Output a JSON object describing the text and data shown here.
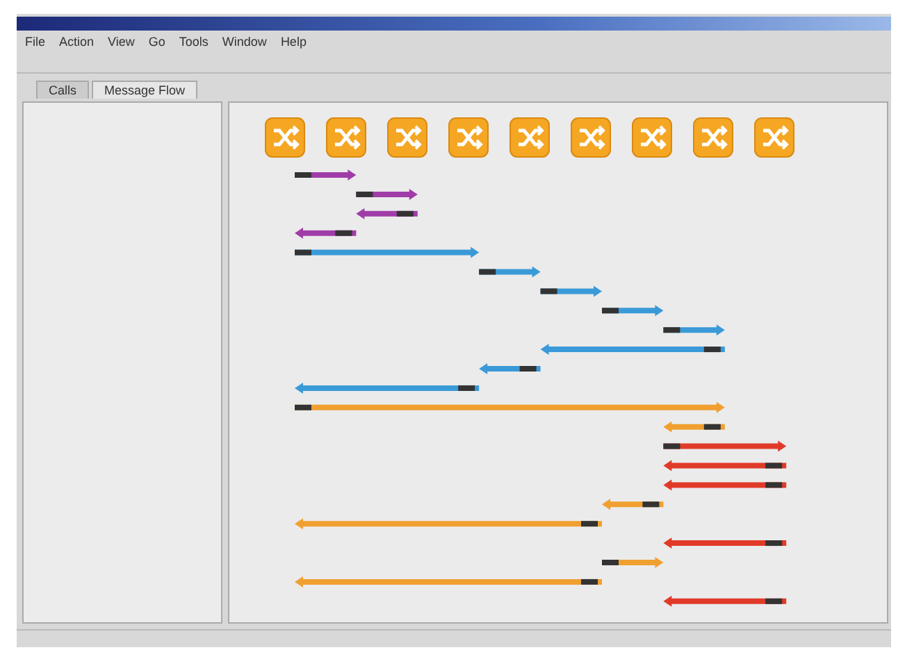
{
  "menu": [
    "File",
    "Action",
    "View",
    "Go",
    "Tools",
    "Window",
    "Help"
  ],
  "tabs": [
    {
      "label": "Calls",
      "selected": false
    },
    {
      "label": "Message Flow",
      "selected": true
    }
  ],
  "nodes": [
    {
      "kind": "switch"
    },
    {
      "kind": "switch"
    },
    {
      "kind": "switch"
    },
    {
      "kind": "switch"
    },
    {
      "kind": "switch"
    },
    {
      "kind": "switch"
    },
    {
      "kind": "switch"
    },
    {
      "kind": "switch"
    },
    {
      "kind": "switch"
    }
  ],
  "messages": [
    {
      "color": "#a03ca8",
      "lanes": [
        {
          "kind": "tail"
        },
        {
          "kind": "head"
        }
      ]
    },
    {
      "color": "#a03ca8",
      "lanes": [
        {
          "kind": "none"
        },
        {
          "kind": "tail"
        },
        {
          "kind": "head"
        }
      ]
    },
    {
      "color": "#a03ca8",
      "lanes": [
        {
          "kind": "none"
        },
        {
          "kind": "head"
        },
        {
          "kind": "tail"
        }
      ]
    },
    {
      "color": "#a03ca8",
      "lanes": [
        {
          "kind": "head"
        },
        {
          "kind": "tail"
        }
      ]
    },
    {
      "color": "#3a9ad8",
      "lanes": [
        {
          "kind": "tail"
        },
        {
          "kind": "pass"
        },
        {
          "kind": "pass"
        },
        {
          "kind": "head"
        }
      ]
    },
    {
      "color": "#3a9ad8",
      "lanes": [
        {
          "kind": "none"
        },
        {
          "kind": "none"
        },
        {
          "kind": "none"
        },
        {
          "kind": "tail"
        },
        {
          "kind": "head"
        }
      ]
    },
    {
      "color": "#3a9ad8",
      "lanes": [
        {
          "kind": "none"
        },
        {
          "kind": "none"
        },
        {
          "kind": "none"
        },
        {
          "kind": "none"
        },
        {
          "kind": "tail"
        },
        {
          "kind": "head"
        }
      ]
    },
    {
      "color": "#3a9ad8",
      "lanes": [
        {
          "kind": "none"
        },
        {
          "kind": "none"
        },
        {
          "kind": "none"
        },
        {
          "kind": "none"
        },
        {
          "kind": "none"
        },
        {
          "kind": "tail"
        },
        {
          "kind": "head"
        }
      ]
    },
    {
      "color": "#3a9ad8",
      "lanes": [
        {
          "kind": "none"
        },
        {
          "kind": "none"
        },
        {
          "kind": "none"
        },
        {
          "kind": "none"
        },
        {
          "kind": "none"
        },
        {
          "kind": "none"
        },
        {
          "kind": "tail"
        },
        {
          "kind": "head"
        }
      ]
    },
    {
      "color": "#3a9ad8",
      "lanes": [
        {
          "kind": "none"
        },
        {
          "kind": "none"
        },
        {
          "kind": "none"
        },
        {
          "kind": "none"
        },
        {
          "kind": "head"
        },
        {
          "kind": "pass"
        },
        {
          "kind": "pass"
        },
        {
          "kind": "tail"
        }
      ]
    },
    {
      "color": "#3a9ad8",
      "lanes": [
        {
          "kind": "none"
        },
        {
          "kind": "none"
        },
        {
          "kind": "none"
        },
        {
          "kind": "head"
        },
        {
          "kind": "tail"
        }
      ]
    },
    {
      "color": "#3a9ad8",
      "lanes": [
        {
          "kind": "head"
        },
        {
          "kind": "pass"
        },
        {
          "kind": "pass"
        },
        {
          "kind": "tail"
        }
      ]
    },
    {
      "color": "#f0a030",
      "lanes": [
        {
          "kind": "tail"
        },
        {
          "kind": "pass"
        },
        {
          "kind": "pass"
        },
        {
          "kind": "pass"
        },
        {
          "kind": "pass"
        },
        {
          "kind": "pass"
        },
        {
          "kind": "pass"
        },
        {
          "kind": "head"
        }
      ]
    },
    {
      "color": "#f0a030",
      "lanes": [
        {
          "kind": "none"
        },
        {
          "kind": "none"
        },
        {
          "kind": "none"
        },
        {
          "kind": "none"
        },
        {
          "kind": "none"
        },
        {
          "kind": "none"
        },
        {
          "kind": "head"
        },
        {
          "kind": "tail"
        }
      ]
    },
    {
      "color": "#e03a28",
      "lanes": [
        {
          "kind": "none"
        },
        {
          "kind": "none"
        },
        {
          "kind": "none"
        },
        {
          "kind": "none"
        },
        {
          "kind": "none"
        },
        {
          "kind": "none"
        },
        {
          "kind": "tail"
        },
        {
          "kind": "pass"
        },
        {
          "kind": "head"
        }
      ]
    },
    {
      "color": "#e03a28",
      "lanes": [
        {
          "kind": "none"
        },
        {
          "kind": "none"
        },
        {
          "kind": "none"
        },
        {
          "kind": "none"
        },
        {
          "kind": "none"
        },
        {
          "kind": "none"
        },
        {
          "kind": "head"
        },
        {
          "kind": "pass"
        },
        {
          "kind": "tail"
        }
      ]
    },
    {
      "color": "#e03a28",
      "lanes": [
        {
          "kind": "none"
        },
        {
          "kind": "none"
        },
        {
          "kind": "none"
        },
        {
          "kind": "none"
        },
        {
          "kind": "none"
        },
        {
          "kind": "none"
        },
        {
          "kind": "head"
        },
        {
          "kind": "pass"
        },
        {
          "kind": "tail"
        }
      ]
    },
    {
      "color": "#f0a030",
      "lanes": [
        {
          "kind": "none"
        },
        {
          "kind": "none"
        },
        {
          "kind": "none"
        },
        {
          "kind": "none"
        },
        {
          "kind": "none"
        },
        {
          "kind": "head"
        },
        {
          "kind": "tail"
        }
      ]
    },
    {
      "color": "#f0a030",
      "lanes": [
        {
          "kind": "head"
        },
        {
          "kind": "pass"
        },
        {
          "kind": "pass"
        },
        {
          "kind": "pass"
        },
        {
          "kind": "pass"
        },
        {
          "kind": "tail"
        }
      ]
    },
    {
      "color": "#e03a28",
      "lanes": [
        {
          "kind": "none"
        },
        {
          "kind": "none"
        },
        {
          "kind": "none"
        },
        {
          "kind": "none"
        },
        {
          "kind": "none"
        },
        {
          "kind": "none"
        },
        {
          "kind": "head"
        },
        {
          "kind": "pass"
        },
        {
          "kind": "tail"
        }
      ]
    },
    {
      "color": "#f0a030",
      "lanes": [
        {
          "kind": "none"
        },
        {
          "kind": "none"
        },
        {
          "kind": "none"
        },
        {
          "kind": "none"
        },
        {
          "kind": "none"
        },
        {
          "kind": "tail"
        },
        {
          "kind": "head"
        }
      ]
    },
    {
      "color": "#f0a030",
      "lanes": [
        {
          "kind": "head"
        },
        {
          "kind": "pass"
        },
        {
          "kind": "pass"
        },
        {
          "kind": "pass"
        },
        {
          "kind": "pass"
        },
        {
          "kind": "tail"
        }
      ]
    },
    {
      "color": "#e03a28",
      "lanes": [
        {
          "kind": "none"
        },
        {
          "kind": "none"
        },
        {
          "kind": "none"
        },
        {
          "kind": "none"
        },
        {
          "kind": "none"
        },
        {
          "kind": "none"
        },
        {
          "kind": "head"
        },
        {
          "kind": "pass"
        },
        {
          "kind": "tail"
        }
      ]
    }
  ]
}
